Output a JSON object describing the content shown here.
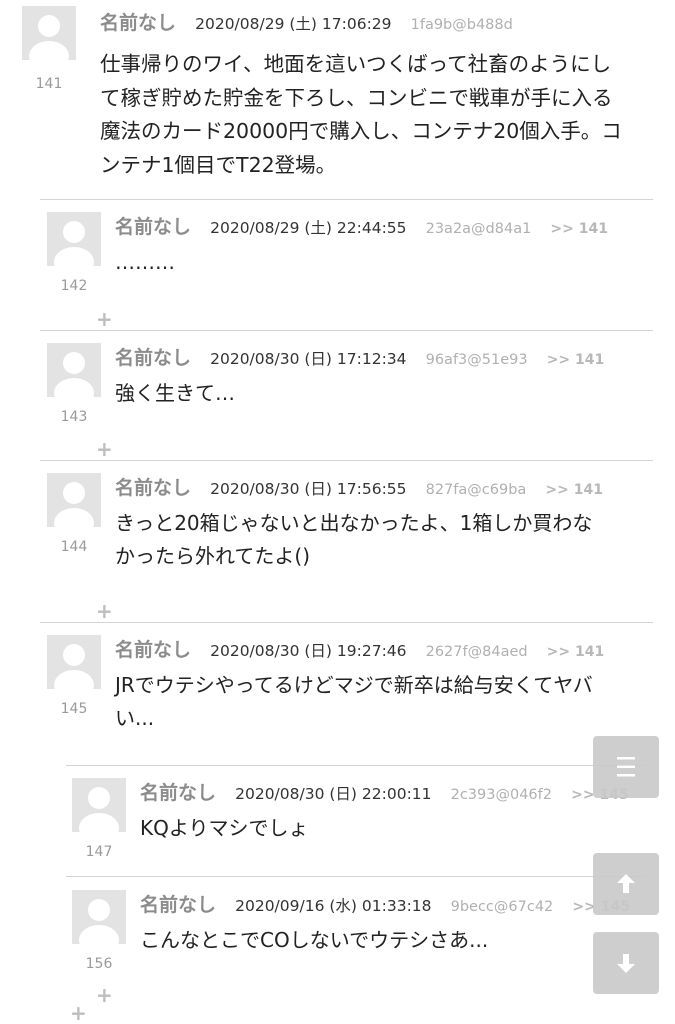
{
  "posts": [
    {
      "num": "141",
      "name": "名前なし",
      "date": "2020/08/29 (土) 17:06:29",
      "uid": "1fa9b@b488d",
      "reply": "",
      "lines": [
        "仕事帰りのワイ、地面を這いつくばって社畜のようにし",
        "て稼ぎ貯めた貯金を下ろし、コンビニで戦車が手に入る",
        "魔法のカード20000円で購入し、コンテナ20個入手。コ",
        "ンテナ1個目でT22登場。"
      ]
    },
    {
      "num": "142",
      "name": "名前なし",
      "date": "2020/08/29 (土) 22:44:55",
      "uid": "23a2a@d84a1",
      "reply": ">> 141",
      "lines": [
        "………"
      ]
    },
    {
      "num": "143",
      "name": "名前なし",
      "date": "2020/08/30 (日) 17:12:34",
      "uid": "96af3@51e93",
      "reply": ">> 141",
      "lines": [
        "強く生きて…"
      ]
    },
    {
      "num": "144",
      "name": "名前なし",
      "date": "2020/08/30 (日) 17:56:55",
      "uid": "827fa@c69ba",
      "reply": ">> 141",
      "lines": [
        "きっと20箱じゃないと出なかったよ、1箱しか買わな",
        "かったら外れてたよ()"
      ]
    },
    {
      "num": "145",
      "name": "名前なし",
      "date": "2020/08/30 (日) 19:27:46",
      "uid": "2627f@84aed",
      "reply": ">> 141",
      "lines": [
        "JRでウテシやってるけどマジで新卒は給与安くてヤバ",
        "い..."
      ]
    },
    {
      "num": "147",
      "name": "名前なし",
      "date": "2020/08/30 (日) 22:00:11",
      "uid": "2c393@046f2",
      "reply": ">> 145",
      "lines": [
        "KQよりマシでしょ"
      ]
    },
    {
      "num": "156",
      "name": "名前なし",
      "date": "2020/09/16 (水) 01:33:18",
      "uid": "9becc@67c42",
      "reply": ">> 145",
      "lines": [
        "こんなとこでCOしないでウテシさあ..."
      ]
    }
  ],
  "plus_symbol": "+",
  "buttons": {
    "menu_icon": "menu-icon",
    "up_icon": "arrow-up-icon",
    "down_icon": "arrow-down-icon"
  },
  "colors": {
    "avatar_bg": "#e3e3e3",
    "button_bg": "#c9c9c9",
    "name": "#8c8c8c",
    "uid": "#b0b0b0"
  }
}
